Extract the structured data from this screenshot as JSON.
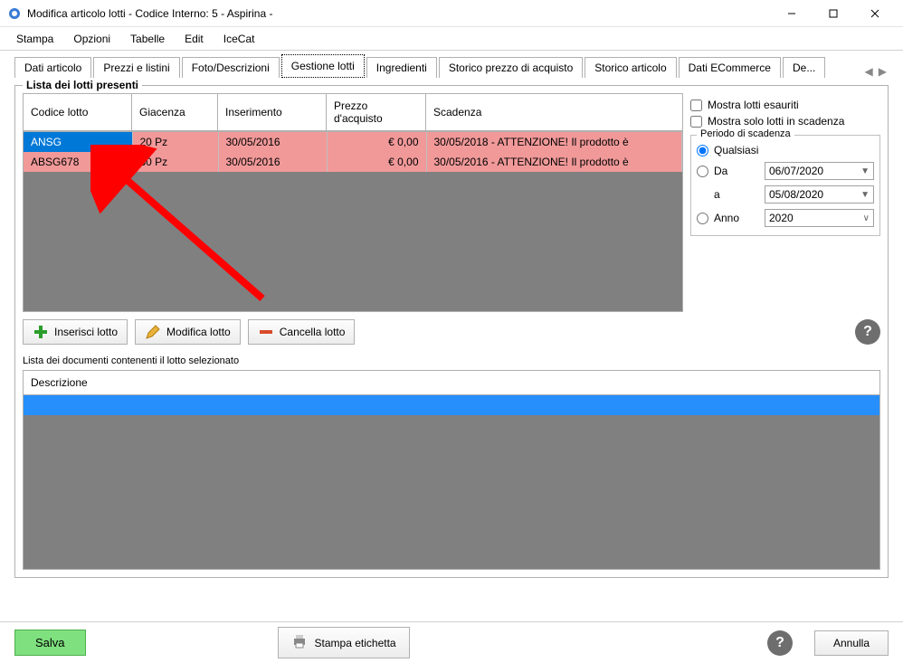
{
  "window": {
    "title": "Modifica articolo lotti - Codice Interno: 5 - Aspirina -"
  },
  "menu": {
    "items": [
      "Stampa",
      "Opzioni",
      "Tabelle",
      "Edit",
      "IceCat"
    ]
  },
  "tabs": {
    "items": [
      "Dati articolo",
      "Prezzi e listini",
      "Foto/Descrizioni",
      "Gestione lotti",
      "Ingredienti",
      "Storico prezzo di acquisto",
      "Storico articolo",
      "Dati ECommerce",
      "De..."
    ],
    "active": 3
  },
  "lots": {
    "legend": "Lista dei lotti presenti",
    "columns": [
      "Codice lotto",
      "Giacenza",
      "Inserimento",
      "Prezzo d'acquisto",
      "Scadenza"
    ],
    "rows": [
      {
        "code": "ANSG",
        "qty": "20 Pz",
        "ins": "30/05/2016",
        "price": "€ 0,00",
        "exp": "30/05/2018 - ATTENZIONE! Il prodotto è",
        "selected": true
      },
      {
        "code": "ABSG678",
        "qty": "30 Pz",
        "ins": "30/05/2016",
        "price": "€ 0,00",
        "exp": "30/05/2016 - ATTENZIONE! Il prodotto è",
        "selected": false
      }
    ]
  },
  "filters": {
    "show_exhausted": "Mostra lotti esauriti",
    "show_expiring": "Mostra solo lotti in scadenza",
    "period_legend": "Periodo di scadenza",
    "any": "Qualsiasi",
    "from": "Da",
    "from_val": "06/07/2020",
    "to": "a",
    "to_val": "05/08/2020",
    "year": "Anno",
    "year_val": "2020"
  },
  "actions": {
    "insert": "Inserisci lotto",
    "edit": "Modifica lotto",
    "delete": "Cancella lotto"
  },
  "docs": {
    "label": "Lista dei documenti contenenti il lotto selezionato",
    "column": "Descrizione"
  },
  "bottom": {
    "save": "Salva",
    "print": "Stampa etichetta",
    "cancel": "Annulla"
  }
}
